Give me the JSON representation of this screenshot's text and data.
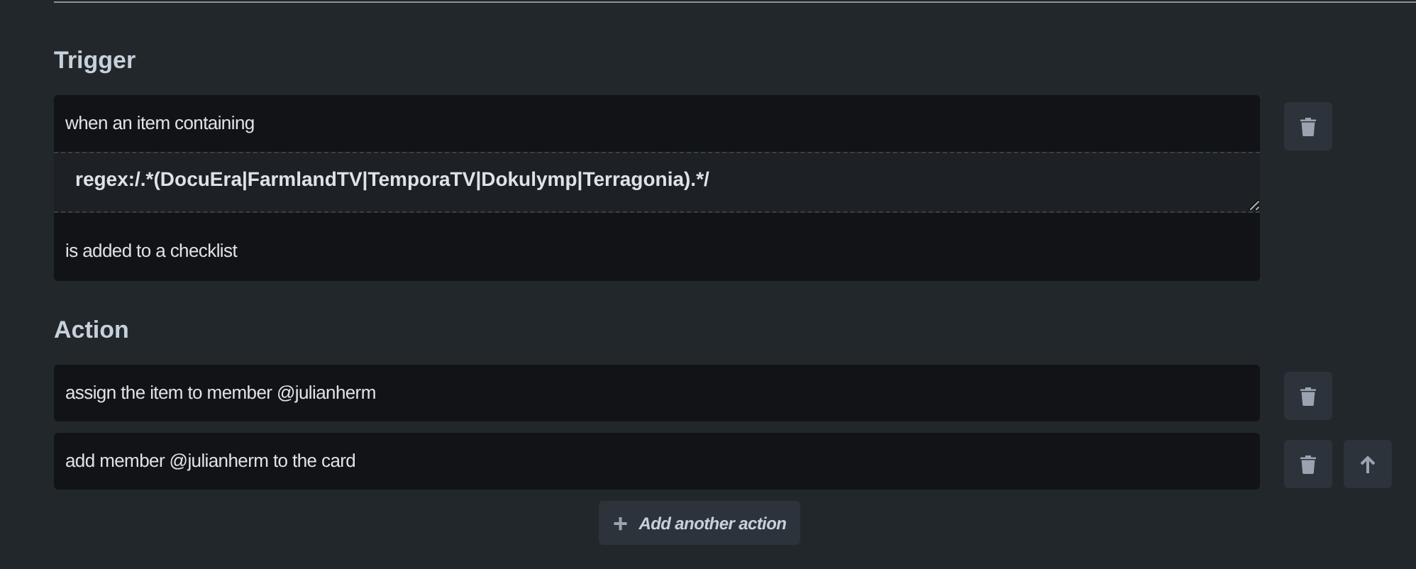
{
  "trigger": {
    "heading": "Trigger",
    "parts": [
      {
        "kind": "text",
        "text": "when an item containing"
      },
      {
        "kind": "input",
        "value": "regex:/.*(DocuEra|FarmlandTV|TemporaTV|Dokulymp|Terragonia).*/"
      },
      {
        "kind": "text",
        "text": "is added to a checklist"
      }
    ]
  },
  "action": {
    "heading": "Action",
    "actions": [
      {
        "text": "assign the item to member @julianherm",
        "move_up": false
      },
      {
        "text": "add member @julianherm to the card",
        "move_up": true
      }
    ],
    "add_button": {
      "icon": "+",
      "label": "Add another action"
    }
  }
}
